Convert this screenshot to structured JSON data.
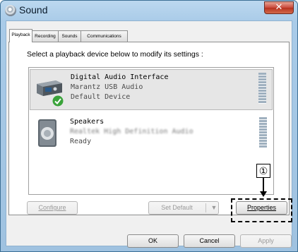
{
  "window": {
    "title": "Sound",
    "close_glyph": "✕"
  },
  "tabs": [
    {
      "label": "Playback",
      "active": true
    },
    {
      "label": "Recording",
      "active": false
    },
    {
      "label": "Sounds",
      "active": false
    },
    {
      "label": "Communications",
      "active": false
    }
  ],
  "instruction": "Select a playback device below to modify its settings :",
  "devices": [
    {
      "name": "Digital Audio Interface",
      "subtitle": "Marantz USB Audio",
      "status": "Default Device",
      "icon": "usb-audio-device-icon",
      "badge": "green-check-icon",
      "selected": true
    },
    {
      "name": "Speakers",
      "subtitle": "Realtek High Definition Audio",
      "status": "Ready",
      "icon": "speaker-icon",
      "selected": false
    }
  ],
  "buttons": {
    "configure": "Configure",
    "set_default": "Set Default",
    "dropdown_glyph": "▼",
    "properties": "Properties",
    "ok": "OK",
    "cancel": "Cancel",
    "apply": "Apply"
  },
  "annotation": {
    "number": "①"
  },
  "colors": {
    "accent_border": "#000000",
    "check_green": "#3aa33a",
    "titlebar": "#a9cbe8"
  }
}
